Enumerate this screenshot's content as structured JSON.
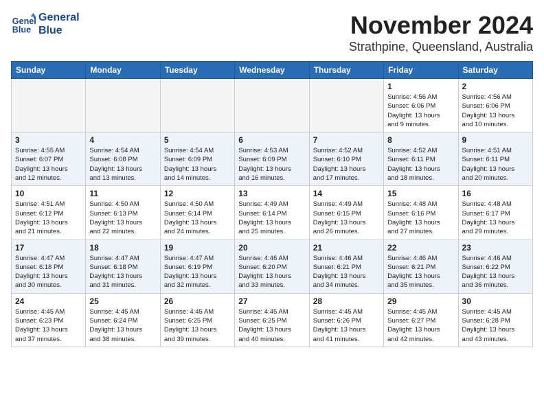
{
  "logo": {
    "line1": "General",
    "line2": "Blue"
  },
  "title": "November 2024",
  "location": "Strathpine, Queensland, Australia",
  "headers": [
    "Sunday",
    "Monday",
    "Tuesday",
    "Wednesday",
    "Thursday",
    "Friday",
    "Saturday"
  ],
  "weeks": [
    [
      {
        "day": "",
        "info": ""
      },
      {
        "day": "",
        "info": ""
      },
      {
        "day": "",
        "info": ""
      },
      {
        "day": "",
        "info": ""
      },
      {
        "day": "",
        "info": ""
      },
      {
        "day": "1",
        "info": "Sunrise: 4:56 AM\nSunset: 6:06 PM\nDaylight: 13 hours\nand 9 minutes."
      },
      {
        "day": "2",
        "info": "Sunrise: 4:56 AM\nSunset: 6:06 PM\nDaylight: 13 hours\nand 10 minutes."
      }
    ],
    [
      {
        "day": "3",
        "info": "Sunrise: 4:55 AM\nSunset: 6:07 PM\nDaylight: 13 hours\nand 12 minutes."
      },
      {
        "day": "4",
        "info": "Sunrise: 4:54 AM\nSunset: 6:08 PM\nDaylight: 13 hours\nand 13 minutes."
      },
      {
        "day": "5",
        "info": "Sunrise: 4:54 AM\nSunset: 6:09 PM\nDaylight: 13 hours\nand 14 minutes."
      },
      {
        "day": "6",
        "info": "Sunrise: 4:53 AM\nSunset: 6:09 PM\nDaylight: 13 hours\nand 16 minutes."
      },
      {
        "day": "7",
        "info": "Sunrise: 4:52 AM\nSunset: 6:10 PM\nDaylight: 13 hours\nand 17 minutes."
      },
      {
        "day": "8",
        "info": "Sunrise: 4:52 AM\nSunset: 6:11 PM\nDaylight: 13 hours\nand 18 minutes."
      },
      {
        "day": "9",
        "info": "Sunrise: 4:51 AM\nSunset: 6:11 PM\nDaylight: 13 hours\nand 20 minutes."
      }
    ],
    [
      {
        "day": "10",
        "info": "Sunrise: 4:51 AM\nSunset: 6:12 PM\nDaylight: 13 hours\nand 21 minutes."
      },
      {
        "day": "11",
        "info": "Sunrise: 4:50 AM\nSunset: 6:13 PM\nDaylight: 13 hours\nand 22 minutes."
      },
      {
        "day": "12",
        "info": "Sunrise: 4:50 AM\nSunset: 6:14 PM\nDaylight: 13 hours\nand 24 minutes."
      },
      {
        "day": "13",
        "info": "Sunrise: 4:49 AM\nSunset: 6:14 PM\nDaylight: 13 hours\nand 25 minutes."
      },
      {
        "day": "14",
        "info": "Sunrise: 4:49 AM\nSunset: 6:15 PM\nDaylight: 13 hours\nand 26 minutes."
      },
      {
        "day": "15",
        "info": "Sunrise: 4:48 AM\nSunset: 6:16 PM\nDaylight: 13 hours\nand 27 minutes."
      },
      {
        "day": "16",
        "info": "Sunrise: 4:48 AM\nSunset: 6:17 PM\nDaylight: 13 hours\nand 29 minutes."
      }
    ],
    [
      {
        "day": "17",
        "info": "Sunrise: 4:47 AM\nSunset: 6:18 PM\nDaylight: 13 hours\nand 30 minutes."
      },
      {
        "day": "18",
        "info": "Sunrise: 4:47 AM\nSunset: 6:18 PM\nDaylight: 13 hours\nand 31 minutes."
      },
      {
        "day": "19",
        "info": "Sunrise: 4:47 AM\nSunset: 6:19 PM\nDaylight: 13 hours\nand 32 minutes."
      },
      {
        "day": "20",
        "info": "Sunrise: 4:46 AM\nSunset: 6:20 PM\nDaylight: 13 hours\nand 33 minutes."
      },
      {
        "day": "21",
        "info": "Sunrise: 4:46 AM\nSunset: 6:21 PM\nDaylight: 13 hours\nand 34 minutes."
      },
      {
        "day": "22",
        "info": "Sunrise: 4:46 AM\nSunset: 6:21 PM\nDaylight: 13 hours\nand 35 minutes."
      },
      {
        "day": "23",
        "info": "Sunrise: 4:46 AM\nSunset: 6:22 PM\nDaylight: 13 hours\nand 36 minutes."
      }
    ],
    [
      {
        "day": "24",
        "info": "Sunrise: 4:45 AM\nSunset: 6:23 PM\nDaylight: 13 hours\nand 37 minutes."
      },
      {
        "day": "25",
        "info": "Sunrise: 4:45 AM\nSunset: 6:24 PM\nDaylight: 13 hours\nand 38 minutes."
      },
      {
        "day": "26",
        "info": "Sunrise: 4:45 AM\nSunset: 6:25 PM\nDaylight: 13 hours\nand 39 minutes."
      },
      {
        "day": "27",
        "info": "Sunrise: 4:45 AM\nSunset: 6:25 PM\nDaylight: 13 hours\nand 40 minutes."
      },
      {
        "day": "28",
        "info": "Sunrise: 4:45 AM\nSunset: 6:26 PM\nDaylight: 13 hours\nand 41 minutes."
      },
      {
        "day": "29",
        "info": "Sunrise: 4:45 AM\nSunset: 6:27 PM\nDaylight: 13 hours\nand 42 minutes."
      },
      {
        "day": "30",
        "info": "Sunrise: 4:45 AM\nSunset: 6:28 PM\nDaylight: 13 hours\nand 43 minutes."
      }
    ]
  ]
}
